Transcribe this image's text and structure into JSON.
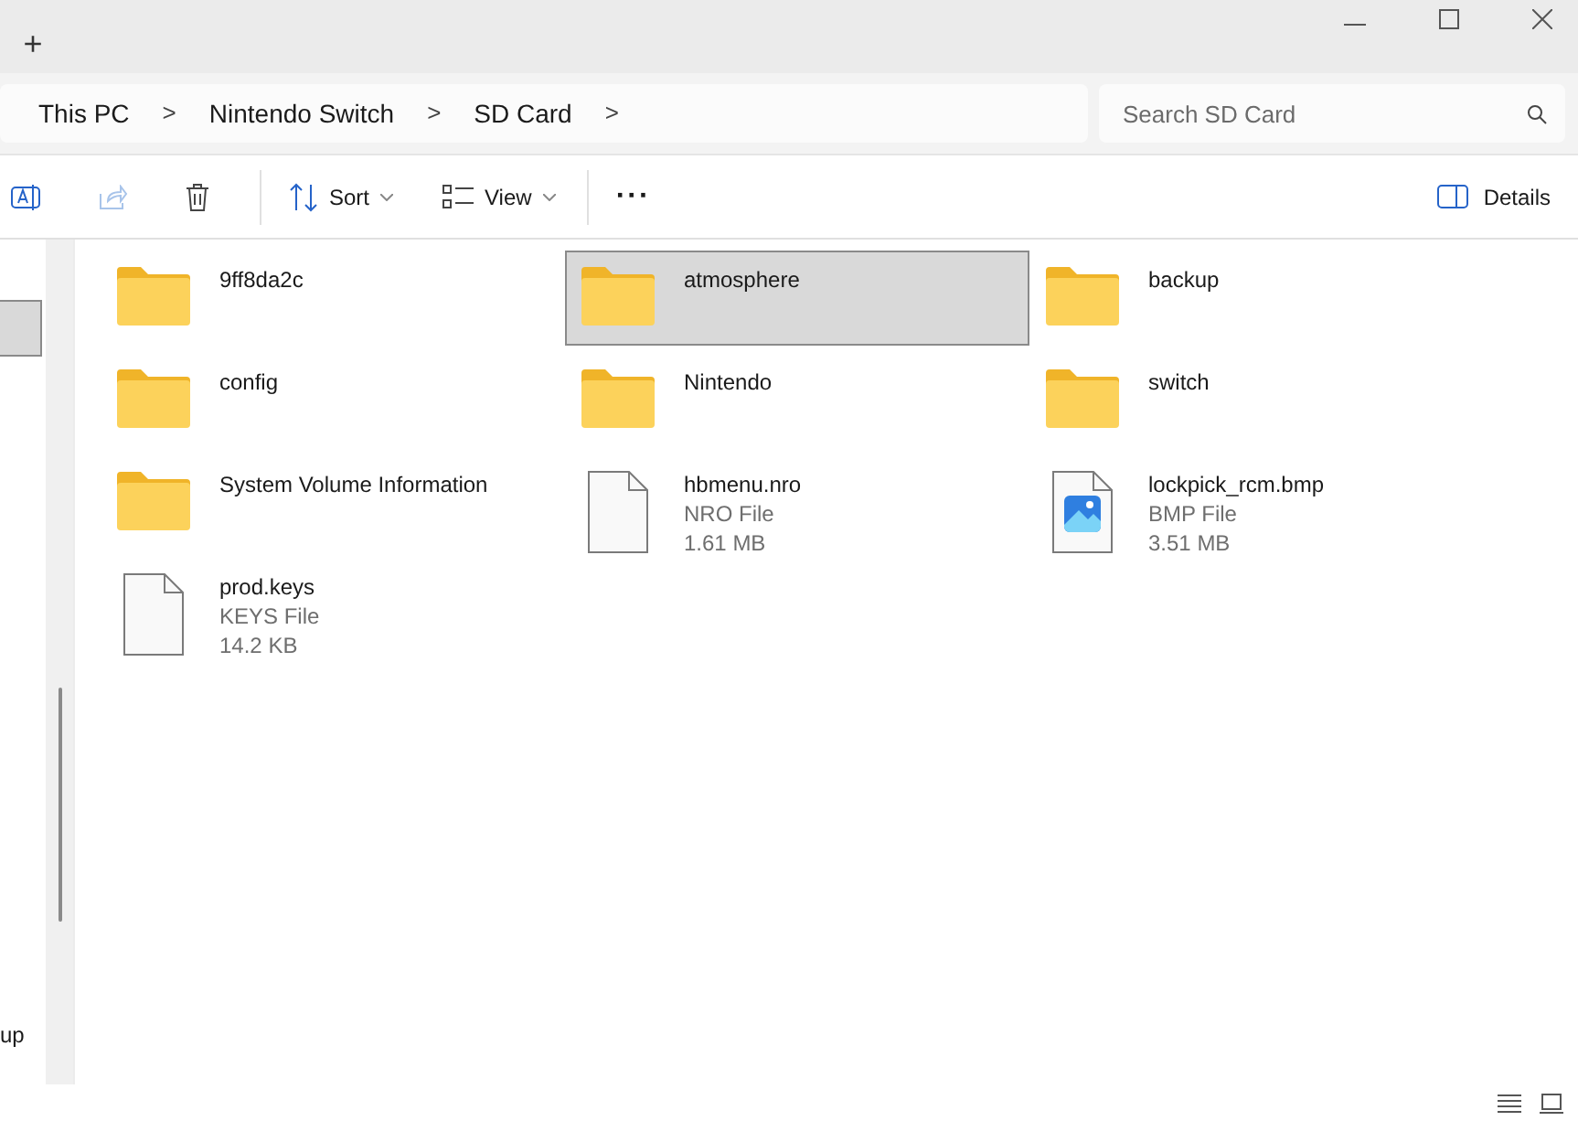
{
  "tab_bar": {
    "new_tab": "+"
  },
  "address_bar": {
    "crumbs": [
      "This PC",
      "Nintendo Switch",
      "SD Card"
    ],
    "separator": ">"
  },
  "search": {
    "placeholder": "Search SD Card"
  },
  "toolbar": {
    "sort": "Sort",
    "view": "View",
    "more": "···",
    "details": "Details"
  },
  "sidebar": {
    "partial_label": "up"
  },
  "items": [
    {
      "kind": "folder",
      "name": "9ff8da2c",
      "selected": false
    },
    {
      "kind": "folder",
      "name": "atmosphere",
      "selected": true
    },
    {
      "kind": "folder",
      "name": "backup",
      "selected": false
    },
    {
      "kind": "folder",
      "name": "config",
      "selected": false
    },
    {
      "kind": "folder",
      "name": "Nintendo",
      "selected": false
    },
    {
      "kind": "folder",
      "name": "switch",
      "selected": false
    },
    {
      "kind": "folder",
      "name": "System Volume Information",
      "selected": false
    },
    {
      "kind": "file",
      "name": "hbmenu.nro",
      "type": "NRO File",
      "size": "1.61 MB",
      "selected": false
    },
    {
      "kind": "image",
      "name": "lockpick_rcm.bmp",
      "type": "BMP File",
      "size": "3.51 MB",
      "selected": false
    },
    {
      "kind": "file",
      "name": "prod.keys",
      "type": "KEYS File",
      "size": "14.2 KB",
      "selected": false
    }
  ]
}
